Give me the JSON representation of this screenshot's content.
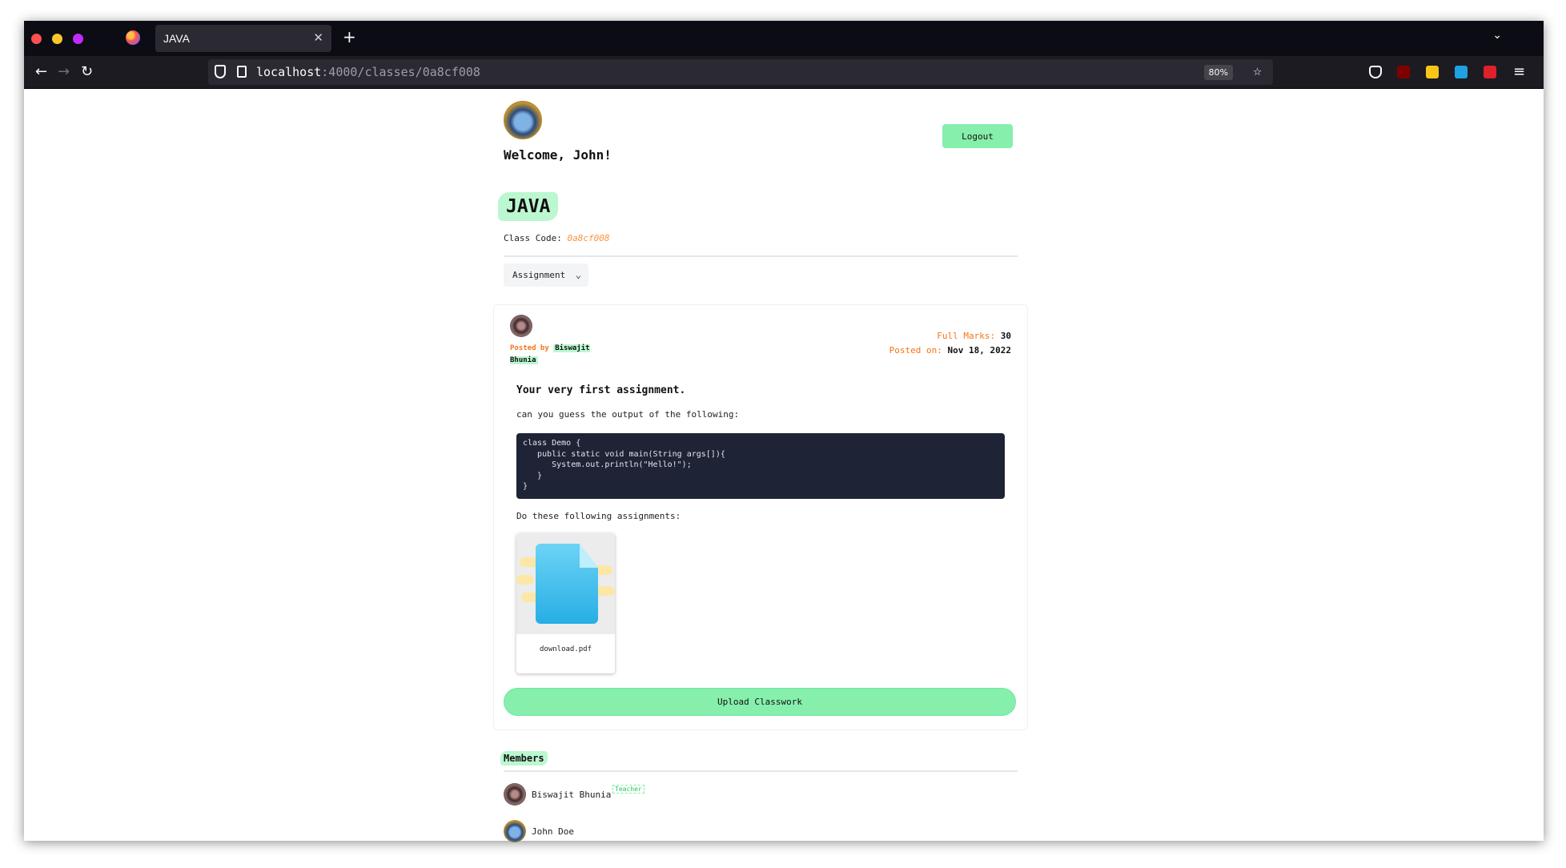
{
  "browser": {
    "tab_title": "JAVA",
    "url_host": "localhost",
    "url_path": ":4000/classes/0a8cf008",
    "zoom": "80%"
  },
  "header": {
    "welcome": "Welcome, John!",
    "logout_label": "Logout"
  },
  "class": {
    "name": "JAVA",
    "code_label": "Class Code:",
    "code": "0a8cf008"
  },
  "filter": {
    "selected": "Assignment"
  },
  "assignment": {
    "posted_by_label": "Posted by",
    "posted_by_name": "Biswajit Bhunia",
    "full_marks_label": "Full Marks:",
    "full_marks": "30",
    "posted_on_label": "Posted on:",
    "posted_on": "Nov 18, 2022",
    "title": "Your very first assignment.",
    "description": "can you guess the output of the following:",
    "code": "class Demo {\n   public static void main(String args[]){\n      System.out.println(\"Hello!\");\n   }\n}",
    "description2": "Do these following assignments:",
    "attachment_name": "download.pdf",
    "upload_label": "Upload Classwork"
  },
  "members": {
    "title": "Members",
    "list": [
      {
        "name": "Biswajit Bhunia",
        "badge": "Teacher"
      },
      {
        "name": "John Doe",
        "badge": ""
      }
    ]
  },
  "colors": {
    "accent_green": "#86efac",
    "accent_orange": "#f97316",
    "code_bg": "#1e2336"
  }
}
